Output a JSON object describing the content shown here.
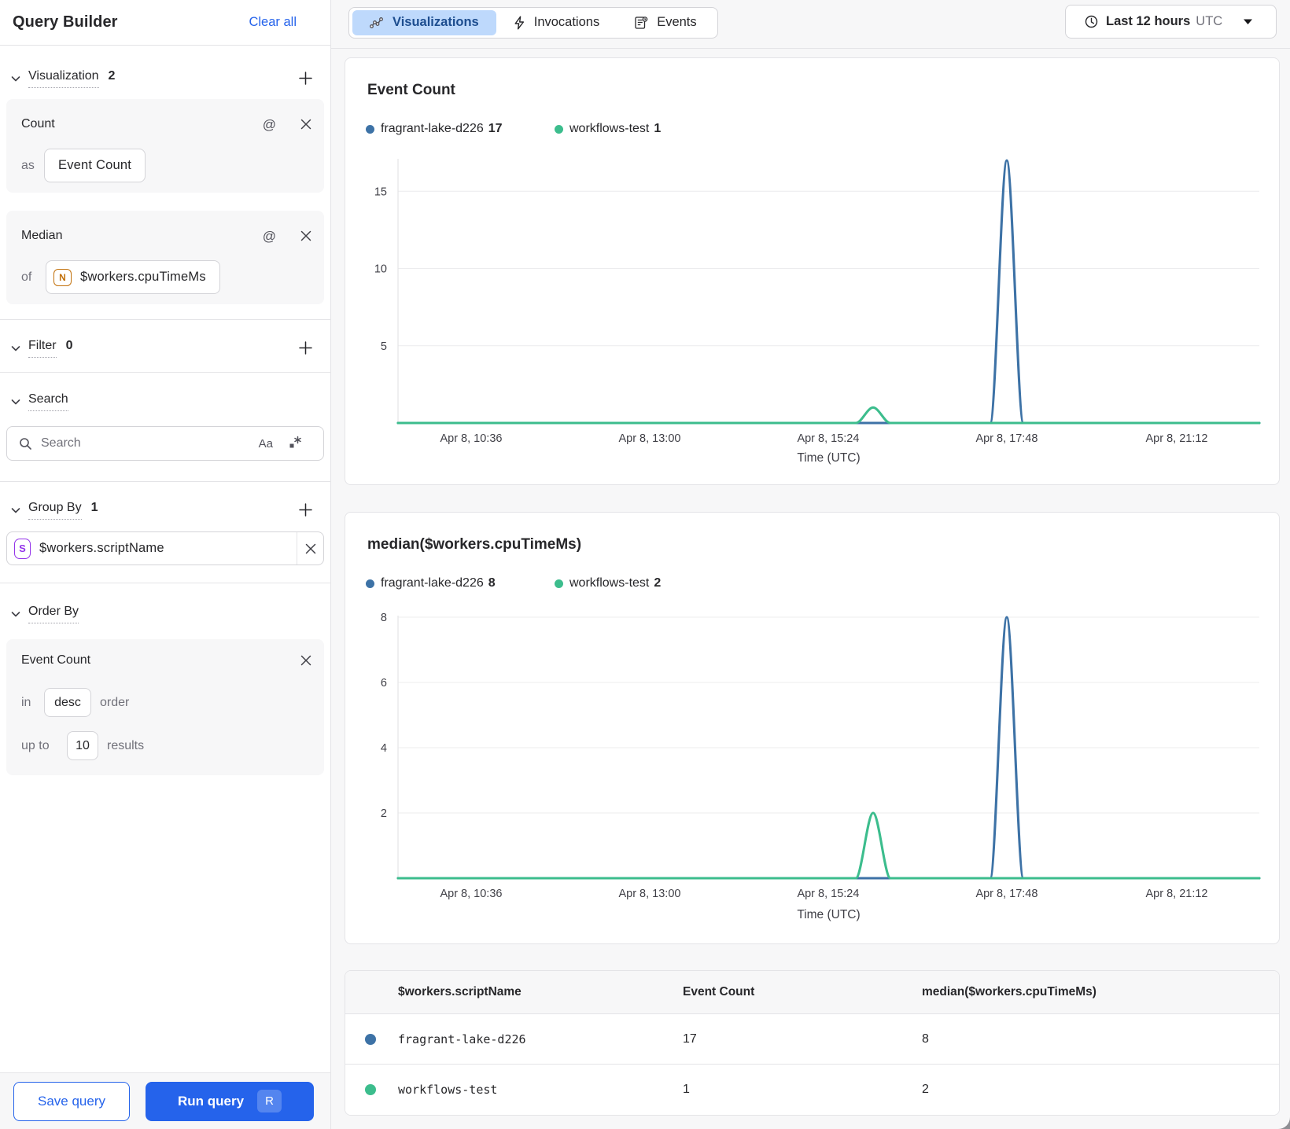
{
  "colors": {
    "accent_blue": "#2563eb",
    "series_blue": "#3d72a6",
    "series_green": "#3cbd8d",
    "tab_active_bg": "#bed9fc",
    "tab_active_text": "#1d4d8f",
    "badge_string": "#9333ea",
    "badge_number": "#c2710c"
  },
  "sidebar": {
    "title": "Query Builder",
    "clear_all": "Clear all",
    "visualization": {
      "label": "Visualization",
      "count": "2",
      "cards": [
        {
          "fn": "Count",
          "prep": "as",
          "value": "Event Count",
          "badge": ""
        },
        {
          "fn": "Median",
          "prep": "of",
          "value": "$workers.cpuTimeMs",
          "badge": "N"
        }
      ]
    },
    "filter": {
      "label": "Filter",
      "count": "0"
    },
    "search": {
      "label": "Search",
      "placeholder": "Search",
      "match_case": "Aa",
      "regex": ".*"
    },
    "group_by": {
      "label": "Group By",
      "count": "1",
      "items": [
        {
          "badge": "S",
          "value": "$workers.scriptName"
        }
      ]
    },
    "order_by": {
      "label": "Order By",
      "field": "Event Count",
      "in_label": "in",
      "direction": "desc",
      "order_label": "order",
      "up_to_label": "up to",
      "limit": "10",
      "results_label": "results"
    },
    "save_button": "Save query",
    "run_button": "Run query",
    "run_shortcut": "R"
  },
  "topbar": {
    "tabs": [
      {
        "label": "Visualizations",
        "icon": "chart-line-icon",
        "active": true
      },
      {
        "label": "Invocations",
        "icon": "lightning-icon",
        "active": false
      },
      {
        "label": "Events",
        "icon": "document-icon",
        "active": false
      }
    ],
    "time_range": {
      "label": "Last 12 hours",
      "timezone": "UTC"
    }
  },
  "chart_data": [
    {
      "type": "line",
      "title": "Event Count",
      "xlabel": "Time (UTC)",
      "ylim": [
        0,
        17
      ],
      "yticks": [
        5,
        10,
        15
      ],
      "xticks": [
        {
          "label": "Apr 8, 10:36",
          "f": 0.0849
        },
        {
          "label": "Apr 8, 13:00",
          "f": 0.2922
        },
        {
          "label": "Apr 8, 15:24",
          "f": 0.4995
        },
        {
          "label": "Apr 8, 17:48",
          "f": 0.7068
        },
        {
          "label": "Apr 8, 21:12",
          "f": 0.9041
        }
      ],
      "series": [
        {
          "name": "fragrant-lake-d226",
          "total": "17",
          "color": "#3d72a6",
          "baseline": 0,
          "spikes": [
            {
              "f": 0.7068,
              "peak": 17,
              "halfwidth": 21
            }
          ]
        },
        {
          "name": "workflows-test",
          "total": "1",
          "color": "#3cbd8d",
          "baseline": 0,
          "spikes": [
            {
              "f": 0.5516,
              "peak": 1,
              "halfwidth": 22
            }
          ]
        }
      ],
      "grid": true,
      "legend_position": "top-left"
    },
    {
      "type": "line",
      "title": "median($workers.cpuTimeMs)",
      "xlabel": "Time (UTC)",
      "ylim": [
        0,
        8
      ],
      "yticks": [
        2,
        4,
        6,
        8
      ],
      "xticks": [
        {
          "label": "Apr 8, 10:36",
          "f": 0.0849
        },
        {
          "label": "Apr 8, 13:00",
          "f": 0.2922
        },
        {
          "label": "Apr 8, 15:24",
          "f": 0.4995
        },
        {
          "label": "Apr 8, 17:48",
          "f": 0.7068
        },
        {
          "label": "Apr 8, 21:12",
          "f": 0.9041
        }
      ],
      "series": [
        {
          "name": "fragrant-lake-d226",
          "total": "8",
          "color": "#3d72a6",
          "baseline": 0,
          "spikes": [
            {
              "f": 0.7068,
              "peak": 8,
              "halfwidth": 21
            }
          ]
        },
        {
          "name": "workflows-test",
          "total": "2",
          "color": "#3cbd8d",
          "baseline": 0,
          "spikes": [
            {
              "f": 0.5516,
              "peak": 2,
              "halfwidth": 22
            }
          ]
        }
      ],
      "grid": true,
      "legend_position": "top-left"
    }
  ],
  "table": {
    "columns": [
      "$workers.scriptName",
      "Event Count",
      "median($workers.cpuTimeMs)"
    ],
    "rows": [
      {
        "color": "#3d72a6",
        "name": "fragrant-lake-d226",
        "event_count": "17",
        "median": "8"
      },
      {
        "color": "#3cbd8d",
        "name": "workflows-test",
        "event_count": "1",
        "median": "2"
      }
    ]
  }
}
